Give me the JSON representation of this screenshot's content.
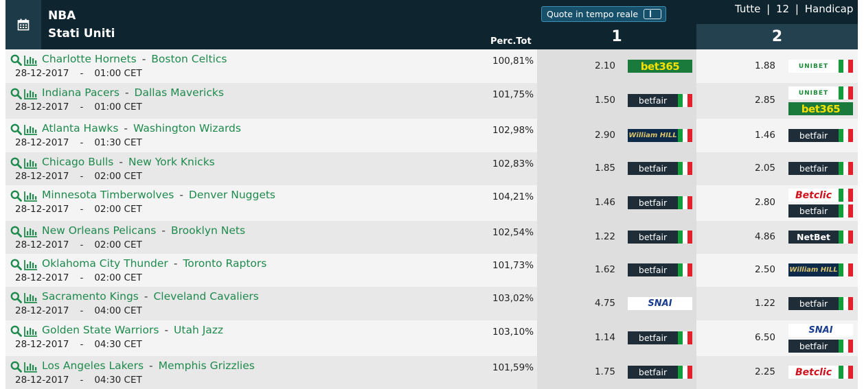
{
  "header": {
    "league": "NBA",
    "country": "Stati Uniti",
    "perc_label": "Perc.Tot",
    "live_button_label": "Quote in tempo reale",
    "filter_all": "Tutte",
    "filter_12": "12",
    "filter_handicap": "Handicap",
    "filter_sep": "|",
    "col1": "1",
    "col2": "2"
  },
  "icons": {
    "calendar": "calendar-icon",
    "search": "search-icon",
    "stats": "bar-chart-icon"
  },
  "team_separator": "-",
  "date_separator": "-",
  "colors": {
    "header_dark": "#0e2530",
    "team_link": "#1f8a4d"
  },
  "matches": [
    {
      "home": "Charlotte Hornets",
      "away": "Boston Celtics",
      "date": "28-12-2017",
      "time": "01:00 CET",
      "perc": "100,81%",
      "odd1": "2.10",
      "bm1": [
        {
          "name": "bet365",
          "label": "bet365",
          "flag": false
        }
      ],
      "odd2": "1.88",
      "bm2": [
        {
          "name": "unibet",
          "label": "UNIBET",
          "flag": true
        }
      ]
    },
    {
      "home": "Indiana Pacers",
      "away": "Dallas Mavericks",
      "date": "28-12-2017",
      "time": "01:00 CET",
      "perc": "101,75%",
      "odd1": "1.50",
      "bm1": [
        {
          "name": "betfair",
          "label": "betfair",
          "flag": true
        }
      ],
      "odd2": "2.85",
      "bm2": [
        {
          "name": "unibet",
          "label": "UNIBET",
          "flag": true
        },
        {
          "name": "bet365",
          "label": "bet365",
          "flag": false
        }
      ]
    },
    {
      "home": "Atlanta Hawks",
      "away": "Washington Wizards",
      "date": "28-12-2017",
      "time": "01:30 CET",
      "perc": "102,98%",
      "odd1": "2.90",
      "bm1": [
        {
          "name": "williamhill",
          "label": "William HILL",
          "flag": true
        }
      ],
      "odd2": "1.46",
      "bm2": [
        {
          "name": "betfair",
          "label": "betfair",
          "flag": true
        }
      ]
    },
    {
      "home": "Chicago Bulls",
      "away": "New York Knicks",
      "date": "28-12-2017",
      "time": "02:00 CET",
      "perc": "102,83%",
      "odd1": "1.85",
      "bm1": [
        {
          "name": "betfair",
          "label": "betfair",
          "flag": true
        }
      ],
      "odd2": "2.05",
      "bm2": [
        {
          "name": "betfair",
          "label": "betfair",
          "flag": true
        }
      ]
    },
    {
      "home": "Minnesota Timberwolves",
      "away": "Denver Nuggets",
      "date": "28-12-2017",
      "time": "02:00 CET",
      "perc": "104,21%",
      "odd1": "1.46",
      "bm1": [
        {
          "name": "betfair",
          "label": "betfair",
          "flag": true
        }
      ],
      "odd2": "2.80",
      "bm2": [
        {
          "name": "betclic",
          "label": "Betclic",
          "flag": true
        },
        {
          "name": "betfair",
          "label": "betfair",
          "flag": true
        }
      ]
    },
    {
      "home": "New Orleans Pelicans",
      "away": "Brooklyn Nets",
      "date": "28-12-2017",
      "time": "02:00 CET",
      "perc": "102,54%",
      "odd1": "1.22",
      "bm1": [
        {
          "name": "betfair",
          "label": "betfair",
          "flag": true
        }
      ],
      "odd2": "4.86",
      "bm2": [
        {
          "name": "netbet",
          "label": "NetBet",
          "flag": true
        }
      ]
    },
    {
      "home": "Oklahoma City Thunder",
      "away": "Toronto Raptors",
      "date": "28-12-2017",
      "time": "02:00 CET",
      "perc": "101,73%",
      "odd1": "1.62",
      "bm1": [
        {
          "name": "betfair",
          "label": "betfair",
          "flag": true
        }
      ],
      "odd2": "2.50",
      "bm2": [
        {
          "name": "williamhill",
          "label": "William HILL",
          "flag": true
        }
      ]
    },
    {
      "home": "Sacramento Kings",
      "away": "Cleveland Cavaliers",
      "date": "28-12-2017",
      "time": "04:00 CET",
      "perc": "103,02%",
      "odd1": "4.75",
      "bm1": [
        {
          "name": "snai",
          "label": "SNAI",
          "flag": false
        }
      ],
      "odd2": "1.22",
      "bm2": [
        {
          "name": "betfair",
          "label": "betfair",
          "flag": true
        }
      ]
    },
    {
      "home": "Golden State Warriors",
      "away": "Utah Jazz",
      "date": "28-12-2017",
      "time": "04:30 CET",
      "perc": "103,10%",
      "odd1": "1.14",
      "bm1": [
        {
          "name": "betfair",
          "label": "betfair",
          "flag": true
        }
      ],
      "odd2": "6.50",
      "bm2": [
        {
          "name": "snai",
          "label": "SNAI",
          "flag": false
        },
        {
          "name": "betfair",
          "label": "betfair",
          "flag": true
        }
      ]
    },
    {
      "home": "Los Angeles Lakers",
      "away": "Memphis Grizzlies",
      "date": "28-12-2017",
      "time": "04:30 CET",
      "perc": "101,59%",
      "odd1": "1.75",
      "bm1": [
        {
          "name": "betfair",
          "label": "betfair",
          "flag": true
        }
      ],
      "odd2": "2.25",
      "bm2": [
        {
          "name": "betclic",
          "label": "Betclic",
          "flag": true
        }
      ]
    }
  ]
}
